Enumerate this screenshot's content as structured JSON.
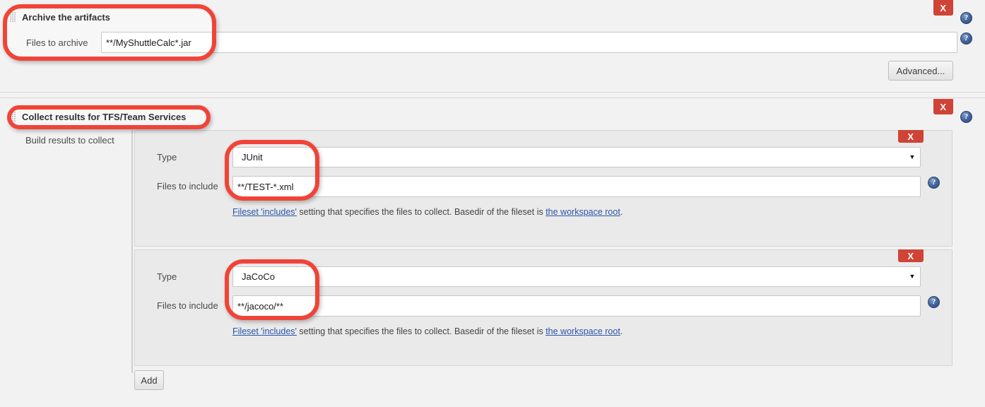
{
  "sections": [
    {
      "id": "archive",
      "title": "Archive the artifacts",
      "grip_name": "drag-handle",
      "close_label": "X",
      "fields": [
        {
          "label": "Files to archive",
          "value": "**/MyShuttleCalc*.jar"
        }
      ],
      "advanced_label": "Advanced..."
    },
    {
      "id": "collect",
      "title": "Collect results for TFS/Team Services",
      "close_label": "X",
      "group_label": "Build results to collect",
      "items": [
        {
          "close_label": "X",
          "type_label": "Type",
          "type_value": "JUnit",
          "files_label": "Files to include",
          "files_value": "**/TEST-*.xml",
          "hint": {
            "link1": "Fileset 'includes'",
            "mid": " setting that specifies the files to collect. Basedir of the fileset is ",
            "link2": "the workspace root",
            "end": "."
          }
        },
        {
          "close_label": "X",
          "type_label": "Type",
          "type_value": "JaCoCo",
          "files_label": "Files to include",
          "files_value": "**/jacoco/**",
          "hint": {
            "link1": "Fileset 'includes'",
            "mid": " setting that specifies the files to collect. Basedir of the fileset is ",
            "link2": "the workspace root",
            "end": "."
          }
        }
      ],
      "add_label": "Add"
    }
  ],
  "icons": {
    "help": "?",
    "caret_down": "▼"
  },
  "colors": {
    "annotation": "#f04438",
    "close_button": "#cf4436",
    "help_icon": "#40619b",
    "link": "#2a56a8",
    "panel_bg": "#eaeaea",
    "page_bg": "#f2f2f2"
  }
}
